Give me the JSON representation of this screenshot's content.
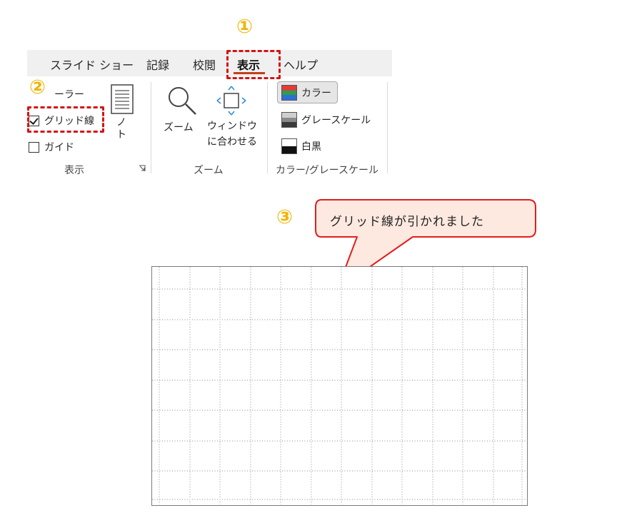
{
  "markers": {
    "step1": "①",
    "step2": "②",
    "step3": "③"
  },
  "tabs": [
    {
      "label": "スライド ショー"
    },
    {
      "label": "記録"
    },
    {
      "label": "校閲"
    },
    {
      "label": "表示",
      "active": true
    },
    {
      "label": "ヘルプ"
    }
  ],
  "show_group": {
    "ruler_label": "ルーラー",
    "ruler_checked": false,
    "gridlines_label": "グリッド線",
    "gridlines_checked": true,
    "guides_label": "ガイド",
    "guides_checked": false,
    "notes_label_line1": "ノ",
    "notes_label_line2": "ー",
    "notes_label_line3": "ト",
    "group_label": "表示"
  },
  "zoom_group": {
    "zoom_label": "ズーム",
    "fit_label_line1": "ウィンドウ",
    "fit_label_line2": "に合わせる",
    "group_label": "ズーム"
  },
  "color_group": {
    "color_label": "カラー",
    "grayscale_label": "グレースケール",
    "bw_label": "白黒",
    "group_label": "カラー/グレースケール"
  },
  "callout": {
    "text": "グリッド線が引かれました"
  },
  "colors": {
    "highlight": "#d21414",
    "marker": "#f0b400",
    "callout_border": "#e01e1e",
    "callout_fill": "#fde9e0",
    "tab_underline": "#c43e1c"
  }
}
